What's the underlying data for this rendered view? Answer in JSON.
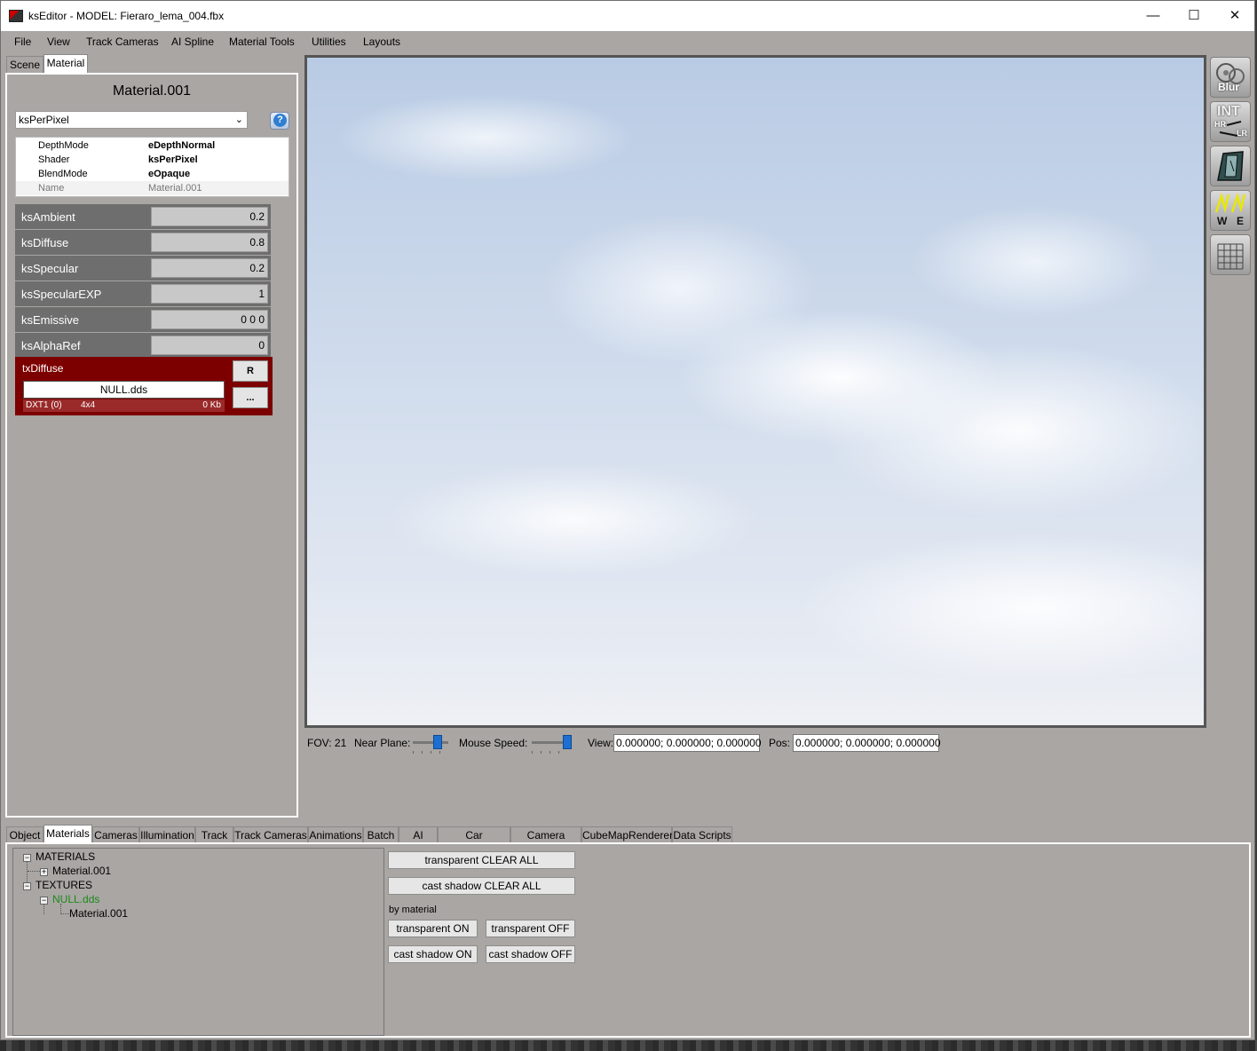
{
  "window": {
    "title": "ksEditor - MODEL: Fieraro_lema_004.fbx",
    "minimize_glyph": "—",
    "maximize_glyph": "☐",
    "close_glyph": "✕"
  },
  "menu": {
    "items": [
      "File",
      "View",
      "Track Cameras",
      "AI Spline",
      "Material Tools",
      "Utilities",
      "Layouts"
    ]
  },
  "top_tabs": [
    "Scene",
    "Material"
  ],
  "material": {
    "title": "Material.001",
    "shader_select": "ksPerPixel",
    "help_glyph": "?",
    "properties": [
      {
        "key": "DepthMode",
        "value": "eDepthNormal"
      },
      {
        "key": "Shader",
        "value": "ksPerPixel"
      },
      {
        "key": "BlendMode",
        "value": "eOpaque"
      },
      {
        "key": "Name",
        "value": "Material.001"
      }
    ],
    "params": [
      {
        "label": "ksAmbient",
        "value": "0.2"
      },
      {
        "label": "ksDiffuse",
        "value": "0.8"
      },
      {
        "label": "ksSpecular",
        "value": "0.2"
      },
      {
        "label": "ksSpecularEXP",
        "value": "1"
      },
      {
        "label": "ksEmissive",
        "value": "0 0 0"
      },
      {
        "label": "ksAlphaRef",
        "value": "0"
      }
    ],
    "texture": {
      "slot": "txDiffuse",
      "file": "NULL.dds",
      "format": "DXT1 (0)",
      "size": "4x4",
      "filesize": "0 Kb",
      "reset_label": "R",
      "browse_label": "..."
    }
  },
  "right_tools": [
    {
      "icon": "blur-icon",
      "label": "Blur"
    },
    {
      "icon": "int-hr-lr-icon",
      "label": "INT",
      "sub1": "HR",
      "sub2": "LR"
    },
    {
      "icon": "car-body-icon",
      "label": ""
    },
    {
      "icon": "wheels-we-icon",
      "label": "W",
      "label2": "E"
    },
    {
      "icon": "grid-icon",
      "label": ""
    }
  ],
  "status": {
    "fov": "FOV: 21",
    "near_plane_label": "Near Plane:",
    "mouse_speed_label": "Mouse Speed:",
    "view_label": "View:",
    "view_value": "0.000000; 0.000000; 0.000000",
    "pos_label": "Pos:",
    "pos_value": "0.000000; 0.000000; 0.000000"
  },
  "bottom_tabs": [
    "Object",
    "Materials",
    "Cameras",
    "Illumination",
    "Track",
    "Track Cameras",
    "Animations",
    "Batch",
    "AI",
    "Car Animations",
    "Camera Spline",
    "CubeMapRenderer",
    "Data Scripts"
  ],
  "tree": {
    "materials_root": "MATERIALS",
    "material_item": "Material.001",
    "textures_root": "TEXTURES",
    "texture_item": "NULL.dds",
    "texture_child": "Material.001",
    "collapse_glyph": "−",
    "expand_glyph": "+"
  },
  "actions": {
    "transparent_clear_all": "transparent CLEAR ALL",
    "cast_shadow_clear_all": "cast shadow CLEAR ALL",
    "by_material": "by material",
    "transparent_on": "transparent ON",
    "transparent_off": "transparent OFF",
    "cast_shadow_on": "cast shadow ON",
    "cast_shadow_off": "cast shadow OFF"
  },
  "colors": {
    "texture_panel": "#7d0000",
    "tree_highlight": "#1a8a1a",
    "slider_thumb": "#1f6fd0"
  }
}
